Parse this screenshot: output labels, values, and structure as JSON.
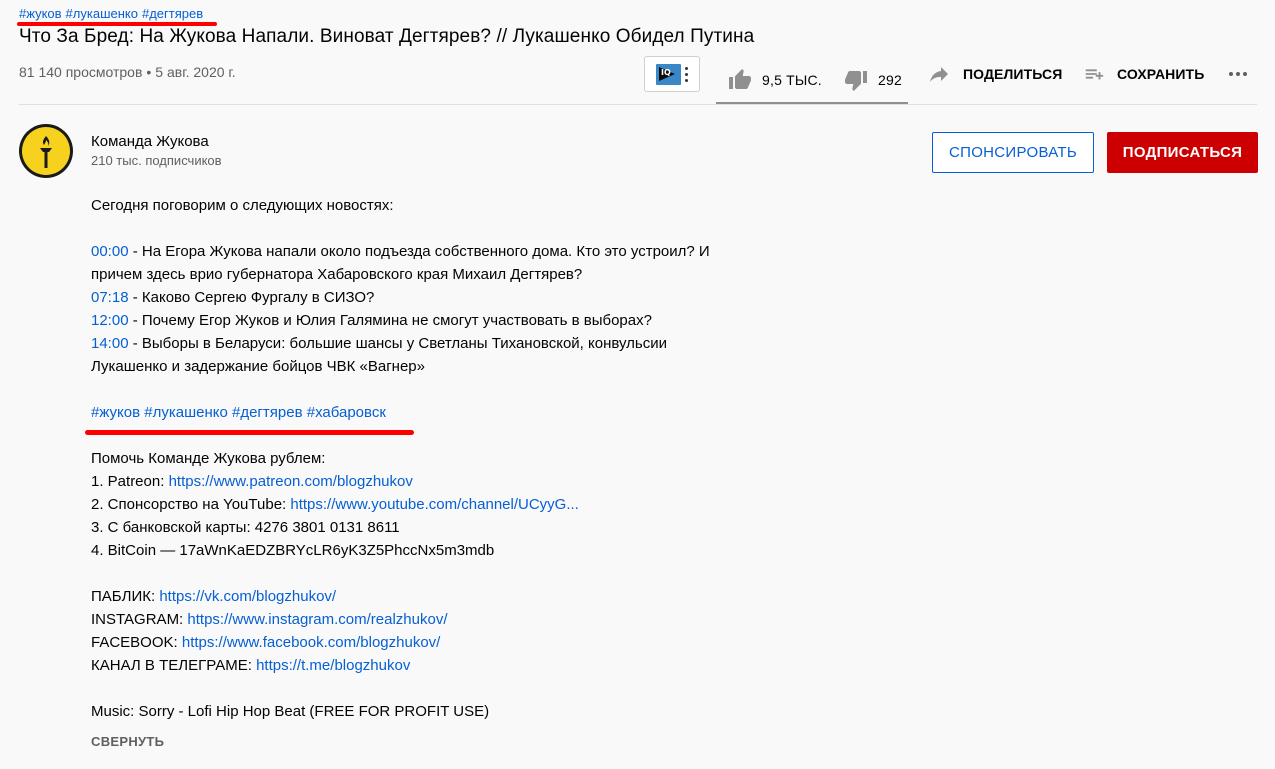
{
  "top_hashtags": [
    "#жуков",
    "#лукашенко",
    "#дегтярев"
  ],
  "video": {
    "title": "Что За Бред: На Жукова Напали. Виноват Дегтярев? // Лукашенко Обидел Путина",
    "views": "81 140 просмотров",
    "separator": "•",
    "date": "5 авг. 2020 г."
  },
  "actions": {
    "likes": "9,5 ТЫС.",
    "dislikes": "292",
    "share_label": "ПОДЕЛИТЬСЯ",
    "save_label": "СОХРАНИТЬ",
    "extension_logo": "IQ"
  },
  "channel": {
    "name": "Команда Жукова",
    "subscribers": "210 тыс. подписчиков",
    "sponsor_label": "СПОНСИРОВАТЬ",
    "subscribe_label": "ПОДПИСАТЬСЯ"
  },
  "description": {
    "intro": "Сегодня поговорим о следующих новостях:",
    "chapters": [
      {
        "time": "00:00",
        "text_lines": [
          " - На Егора Жукова напали около подъезда собственного дома. Кто это устроил? И",
          "причем здесь врио губернатора Хабаровского края Михаил Дегтярев?"
        ]
      },
      {
        "time": "07:18",
        "text_lines": [
          " - Каково Сергею Фургалу в СИЗО?"
        ]
      },
      {
        "time": "12:00",
        "text_lines": [
          " - Почему Егор Жуков и Юлия Галямина не смогут участвовать в выборах?"
        ]
      },
      {
        "time": "14:00",
        "text_lines": [
          " - Выборы в Беларуси: большие шансы у Светланы Тихановской, конвульсии",
          "Лукашенко и задержание бойцов ЧВК «Вагнер»"
        ]
      }
    ],
    "hashtags": [
      "#жуков",
      "#лукашенко",
      "#дегтярев",
      "#хабаровск"
    ],
    "support_title": "Помочь Команде Жукова рублем:",
    "support": [
      {
        "prefix": "1. Patreon: ",
        "link": "https://www.patreon.com/blogzhukov"
      },
      {
        "prefix": "2. Спонсорство на YouTube: ",
        "link": "https://www.youtube.com/channel/UCyyG..."
      },
      {
        "prefix": "3. С банковской карты: 4276 3801 0131 8611",
        "link": ""
      },
      {
        "prefix": "4. BitCoin — 17aWnKaEDZBRYcLR6yK3Z5PhccNx5m3mdb",
        "link": ""
      }
    ],
    "socials": [
      {
        "prefix": "ПАБЛИК: ",
        "link": "https://vk.com/blogzhukov/"
      },
      {
        "prefix": "INSTAGRAM: ",
        "link": "https://www.instagram.com/realzhukov/"
      },
      {
        "prefix": "FACEBOOK: ",
        "link": "https://www.facebook.com/blogzhukov/"
      },
      {
        "prefix": "КАНАЛ В ТЕЛЕГРАМЕ: ",
        "link": "https://t.me/blogzhukov"
      }
    ],
    "music": "Music: Sorry - Lofi Hip Hop Beat (FREE FOR PROFIT USE)",
    "collapse_label": "СВЕРНУТЬ"
  },
  "colors": {
    "link": "#065fd4",
    "subscribe_red": "#cc0000",
    "annotation_red": "#ff0000",
    "secondary_text": "#606060"
  }
}
